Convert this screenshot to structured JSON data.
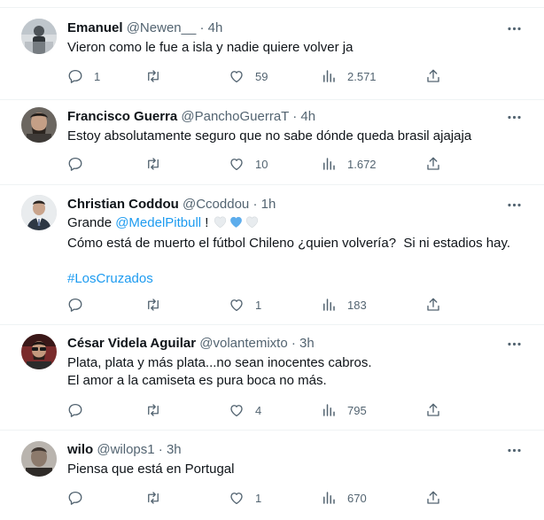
{
  "tweets": [
    {
      "name": "Emanuel",
      "handle": "@Newen__",
      "time": "4h",
      "text": "Vieron como le fue a isla y nadie quiere volver ja",
      "replies": "1",
      "retweets": "",
      "likes": "59",
      "views": "2.571"
    },
    {
      "name": "Francisco Guerra",
      "handle": "@PanchoGuerraT",
      "time": "4h",
      "text": "Estoy absolutamente seguro que no sabe dónde queda brasil ajajaja",
      "replies": "",
      "retweets": "",
      "likes": "10",
      "views": "1.672"
    },
    {
      "name": "Christian Coddou",
      "handle": "@Ccoddou",
      "time": "1h",
      "text_prefix": "Grande ",
      "mention": "@MedelPitbull",
      "text_after_mention": " ! ",
      "text_line2": "Cómo está de muerto el fútbol Chileno ¿quien volvería?  Si ni estadios hay.",
      "hashtag": "#LosCruzados",
      "replies": "",
      "retweets": "",
      "likes": "1",
      "views": "183"
    },
    {
      "name": "César Videla Aguilar",
      "handle": "@volantemixto",
      "time": "3h",
      "text": "Plata, plata y más plata...no sean inocentes cabros.\nEl amor a la camiseta es pura boca no más.",
      "replies": "",
      "retweets": "",
      "likes": "4",
      "views": "795"
    },
    {
      "name": "wilo",
      "handle": "@wilops1",
      "time": "3h",
      "text": "Piensa que está en Portugal",
      "replies": "",
      "retweets": "",
      "likes": "1",
      "views": "670"
    }
  ],
  "separator": "·",
  "colors": {
    "text": "#0f1419",
    "secondary": "#536471",
    "link": "#1d9bf0",
    "border": "#eff3f4",
    "heart_white": "#e8ecef",
    "heart_blue": "#5dadec"
  },
  "icons": [
    "more-icon",
    "reply-icon",
    "retweet-icon",
    "like-icon",
    "views-icon",
    "share-icon",
    "white-heart-icon",
    "blue-heart-icon"
  ]
}
